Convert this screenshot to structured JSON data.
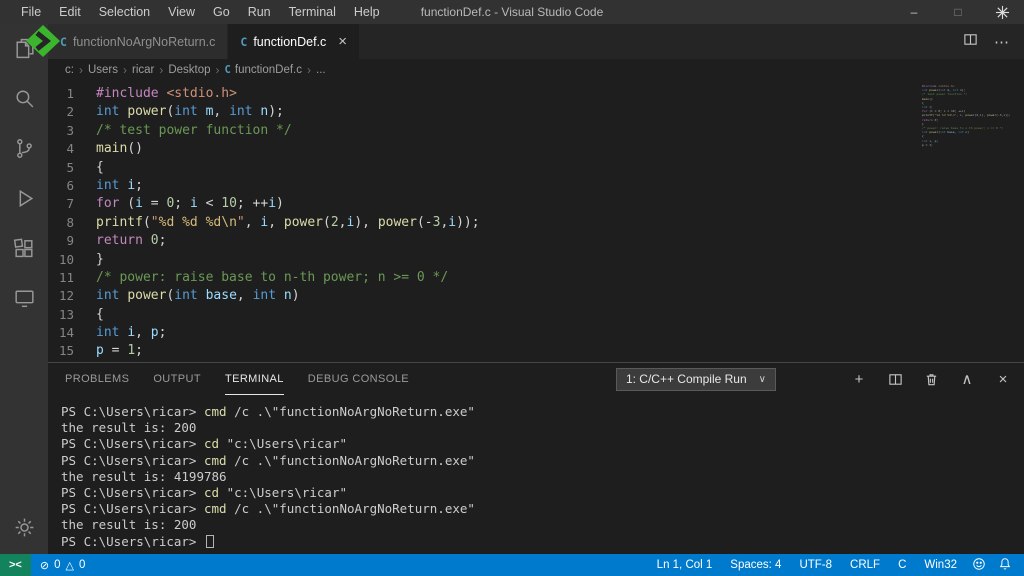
{
  "title_bar": {
    "menus": [
      "File",
      "Edit",
      "Selection",
      "View",
      "Go",
      "Run",
      "Terminal",
      "Help"
    ],
    "title": "functionDef.c - Visual Studio Code"
  },
  "tabs": [
    {
      "label": "functionNoArgNoReturn.c",
      "active": false
    },
    {
      "label": "functionDef.c",
      "active": true
    }
  ],
  "breadcrumb": [
    {
      "label": "c:"
    },
    {
      "label": "Users"
    },
    {
      "label": "ricar"
    },
    {
      "label": "Desktop"
    },
    {
      "label": "functionDef.c",
      "icon": "c"
    },
    {
      "label": "..."
    }
  ],
  "editor": {
    "lines": [
      {
        "num": "1",
        "tokens": [
          [
            "#include",
            "ctrl"
          ],
          [
            " ",
            "def"
          ],
          [
            "<stdio.h>",
            "str"
          ]
        ]
      },
      {
        "num": "2",
        "tokens": [
          [
            "int",
            "kw"
          ],
          [
            " ",
            "def"
          ],
          [
            "power",
            "fn"
          ],
          [
            "(",
            "def"
          ],
          [
            "int",
            "kw"
          ],
          [
            " ",
            "def"
          ],
          [
            "m",
            "var"
          ],
          [
            ", ",
            "def"
          ],
          [
            "int",
            "kw"
          ],
          [
            " ",
            "def"
          ],
          [
            "n",
            "var"
          ],
          [
            ");",
            "def"
          ]
        ]
      },
      {
        "num": "3",
        "tokens": [
          [
            "/* test power function */",
            "com"
          ]
        ]
      },
      {
        "num": "4",
        "tokens": [
          [
            "main",
            "fn"
          ],
          [
            "()",
            "def"
          ]
        ]
      },
      {
        "num": "5",
        "tokens": [
          [
            "{",
            "def"
          ]
        ]
      },
      {
        "num": "6",
        "tokens": [
          [
            "int",
            "kw"
          ],
          [
            " ",
            "def"
          ],
          [
            "i",
            "var"
          ],
          [
            ";",
            "def"
          ]
        ]
      },
      {
        "num": "7",
        "tokens": [
          [
            "for",
            "ctrl"
          ],
          [
            " (",
            "def"
          ],
          [
            "i",
            "var"
          ],
          [
            " = ",
            "def"
          ],
          [
            "0",
            "num"
          ],
          [
            "; ",
            "def"
          ],
          [
            "i",
            "var"
          ],
          [
            " < ",
            "def"
          ],
          [
            "10",
            "num"
          ],
          [
            "; ++",
            "def"
          ],
          [
            "i",
            "var"
          ],
          [
            ")",
            "def"
          ]
        ]
      },
      {
        "num": "8",
        "tokens": [
          [
            "printf",
            "fn"
          ],
          [
            "(",
            "def"
          ],
          [
            "\"",
            "str"
          ],
          [
            "%d %d %d",
            "fmt"
          ],
          [
            "\\n",
            "fmt"
          ],
          [
            "\"",
            "str"
          ],
          [
            ", ",
            "def"
          ],
          [
            "i",
            "var"
          ],
          [
            ", ",
            "def"
          ],
          [
            "power",
            "fn"
          ],
          [
            "(",
            "def"
          ],
          [
            "2",
            "num"
          ],
          [
            ",",
            "def"
          ],
          [
            "i",
            "var"
          ],
          [
            "), ",
            "def"
          ],
          [
            "power",
            "fn"
          ],
          [
            "(-",
            "def"
          ],
          [
            "3",
            "num"
          ],
          [
            ",",
            "def"
          ],
          [
            "i",
            "var"
          ],
          [
            "));",
            "def"
          ]
        ]
      },
      {
        "num": "9",
        "tokens": [
          [
            "return",
            "ctrl"
          ],
          [
            " ",
            "def"
          ],
          [
            "0",
            "num"
          ],
          [
            ";",
            "def"
          ]
        ]
      },
      {
        "num": "10",
        "tokens": [
          [
            "}",
            "def"
          ]
        ]
      },
      {
        "num": "11",
        "tokens": [
          [
            "/* power: raise base to n-th power; n >= 0 */",
            "com"
          ]
        ]
      },
      {
        "num": "12",
        "tokens": [
          [
            "int",
            "kw"
          ],
          [
            " ",
            "def"
          ],
          [
            "power",
            "fn"
          ],
          [
            "(",
            "def"
          ],
          [
            "int",
            "kw"
          ],
          [
            " ",
            "def"
          ],
          [
            "base",
            "var"
          ],
          [
            ", ",
            "def"
          ],
          [
            "int",
            "kw"
          ],
          [
            " ",
            "def"
          ],
          [
            "n",
            "var"
          ],
          [
            ")",
            "def"
          ]
        ]
      },
      {
        "num": "13",
        "tokens": [
          [
            "{",
            "def"
          ]
        ]
      },
      {
        "num": "14",
        "tokens": [
          [
            "int",
            "kw"
          ],
          [
            " ",
            "def"
          ],
          [
            "i",
            "var"
          ],
          [
            ", ",
            "def"
          ],
          [
            "p",
            "var"
          ],
          [
            ";",
            "def"
          ]
        ]
      },
      {
        "num": "15",
        "tokens": [
          [
            "p",
            "var"
          ],
          [
            " = ",
            "def"
          ],
          [
            "1",
            "num"
          ],
          [
            ";",
            "def"
          ]
        ]
      }
    ]
  },
  "panel": {
    "tabs": [
      {
        "label": "PROBLEMS"
      },
      {
        "label": "OUTPUT"
      },
      {
        "label": "TERMINAL",
        "active": true
      },
      {
        "label": "DEBUG CONSOLE"
      }
    ],
    "dropdown_label": "1: C/C++ Compile Run",
    "terminal_lines": [
      {
        "tokens": [
          [
            "PS C:\\Users\\ricar> ",
            "def"
          ],
          [
            "cmd",
            "cmd"
          ],
          [
            " /c .\\\"functionNoArgNoReturn.exe\"",
            "def"
          ]
        ]
      },
      {
        "tokens": [
          [
            "the result is: 200",
            "def"
          ]
        ]
      },
      {
        "tokens": [
          [
            "PS C:\\Users\\ricar> ",
            "def"
          ],
          [
            "cd",
            "cmd"
          ],
          [
            " \"c:\\Users\\ricar\"",
            "def"
          ]
        ]
      },
      {
        "tokens": [
          [
            "PS C:\\Users\\ricar> ",
            "def"
          ],
          [
            "cmd",
            "cmd"
          ],
          [
            " /c .\\\"functionNoArgNoReturn.exe\"",
            "def"
          ]
        ]
      },
      {
        "tokens": [
          [
            "the result is: 4199786",
            "def"
          ]
        ]
      },
      {
        "tokens": [
          [
            "PS C:\\Users\\ricar> ",
            "def"
          ],
          [
            "cd",
            "cmd"
          ],
          [
            " \"c:\\Users\\ricar\"",
            "def"
          ]
        ]
      },
      {
        "tokens": [
          [
            "PS C:\\Users\\ricar> ",
            "def"
          ],
          [
            "cmd",
            "cmd"
          ],
          [
            " /c .\\\"functionNoArgNoReturn.exe\"",
            "def"
          ]
        ]
      },
      {
        "tokens": [
          [
            "the result is: 200",
            "def"
          ]
        ]
      },
      {
        "tokens": [
          [
            "PS C:\\Users\\ricar> ",
            "def"
          ]
        ],
        "cursor": true
      }
    ]
  },
  "status_bar": {
    "remote_glyph": "><",
    "errors": "0",
    "warnings": "0",
    "right_items": [
      "Ln 1, Col 1",
      "Spaces: 4",
      "UTF-8",
      "CRLF",
      "C",
      "Win32"
    ]
  },
  "colors": {
    "accent": "#007acc",
    "remote_green": "#12835c",
    "watermark_green": "#3cb52e",
    "keyword": "#569cd6",
    "control": "#c586c0",
    "function": "#dcdcaa",
    "variable": "#9cdcfe",
    "number": "#b5cea8",
    "string": "#ce9178",
    "comment": "#6a9955"
  }
}
